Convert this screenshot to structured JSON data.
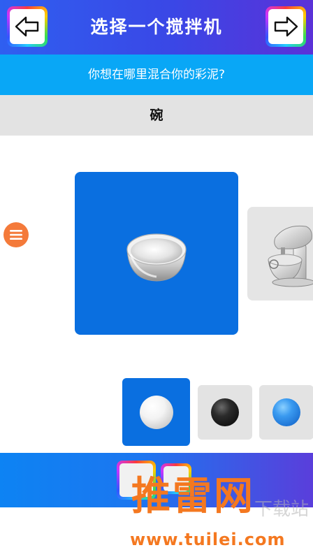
{
  "header": {
    "title": "选择一个搅拌机",
    "back_icon": "arrow-left-icon",
    "forward_icon": "arrow-right-icon"
  },
  "subheader": {
    "text": "你想在哪里混合你的彩泥?"
  },
  "category": {
    "label": "碗"
  },
  "menu": {
    "icon": "hamburger-menu-icon",
    "color": "#f47a3a"
  },
  "mixers": [
    {
      "name": "bowl",
      "selected": true
    },
    {
      "name": "stand-mixer",
      "selected": false
    }
  ],
  "colors": [
    {
      "name": "white",
      "selected": true
    },
    {
      "name": "black",
      "selected": false
    },
    {
      "name": "blue",
      "selected": false
    }
  ],
  "watermark": {
    "brand": "推雷网",
    "faded_text": "下载站",
    "url": "www.tuilei.com"
  },
  "theme": {
    "header_gradient": [
      "#2f5ff0",
      "#5b31d8"
    ],
    "subheader_bg": "#09a7f6",
    "selected_bg": "#0a6fe0",
    "watermark_color": "#f47820"
  }
}
